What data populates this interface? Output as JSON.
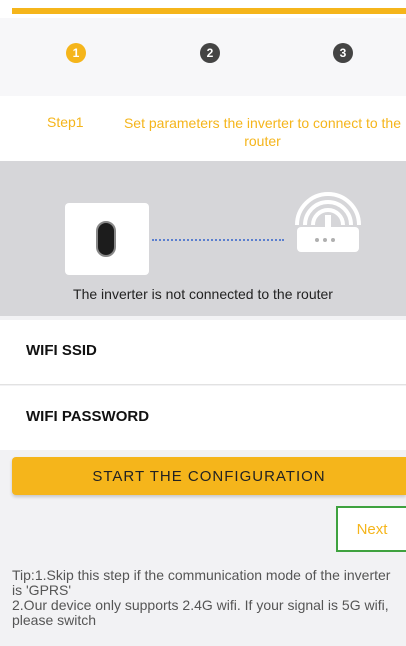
{
  "steps": {
    "items": [
      "1",
      "2",
      "3"
    ],
    "current": 1,
    "active_color": "#f5b51b",
    "inactive_color": "#444444"
  },
  "step_header": {
    "label": "Step1",
    "description": "Set parameters the inverter to connect to the router"
  },
  "illustration": {
    "status_text": "The inverter is not connected to the router"
  },
  "form": {
    "ssid_label": "WIFI SSID",
    "password_label": "WIFI PASSWORD"
  },
  "actions": {
    "start_label": "START THE CONFIGURATION",
    "next_label": "Next"
  },
  "tips": {
    "line1": "Tip:1.Skip this step if the communication mode of the inverter is 'GPRS'",
    "line2": "2.Our device only supports 2.4G wifi. If your signal is 5G wifi, please switch"
  },
  "colors": {
    "accent": "#f5b51b",
    "highlight_border": "#3fa23f"
  }
}
